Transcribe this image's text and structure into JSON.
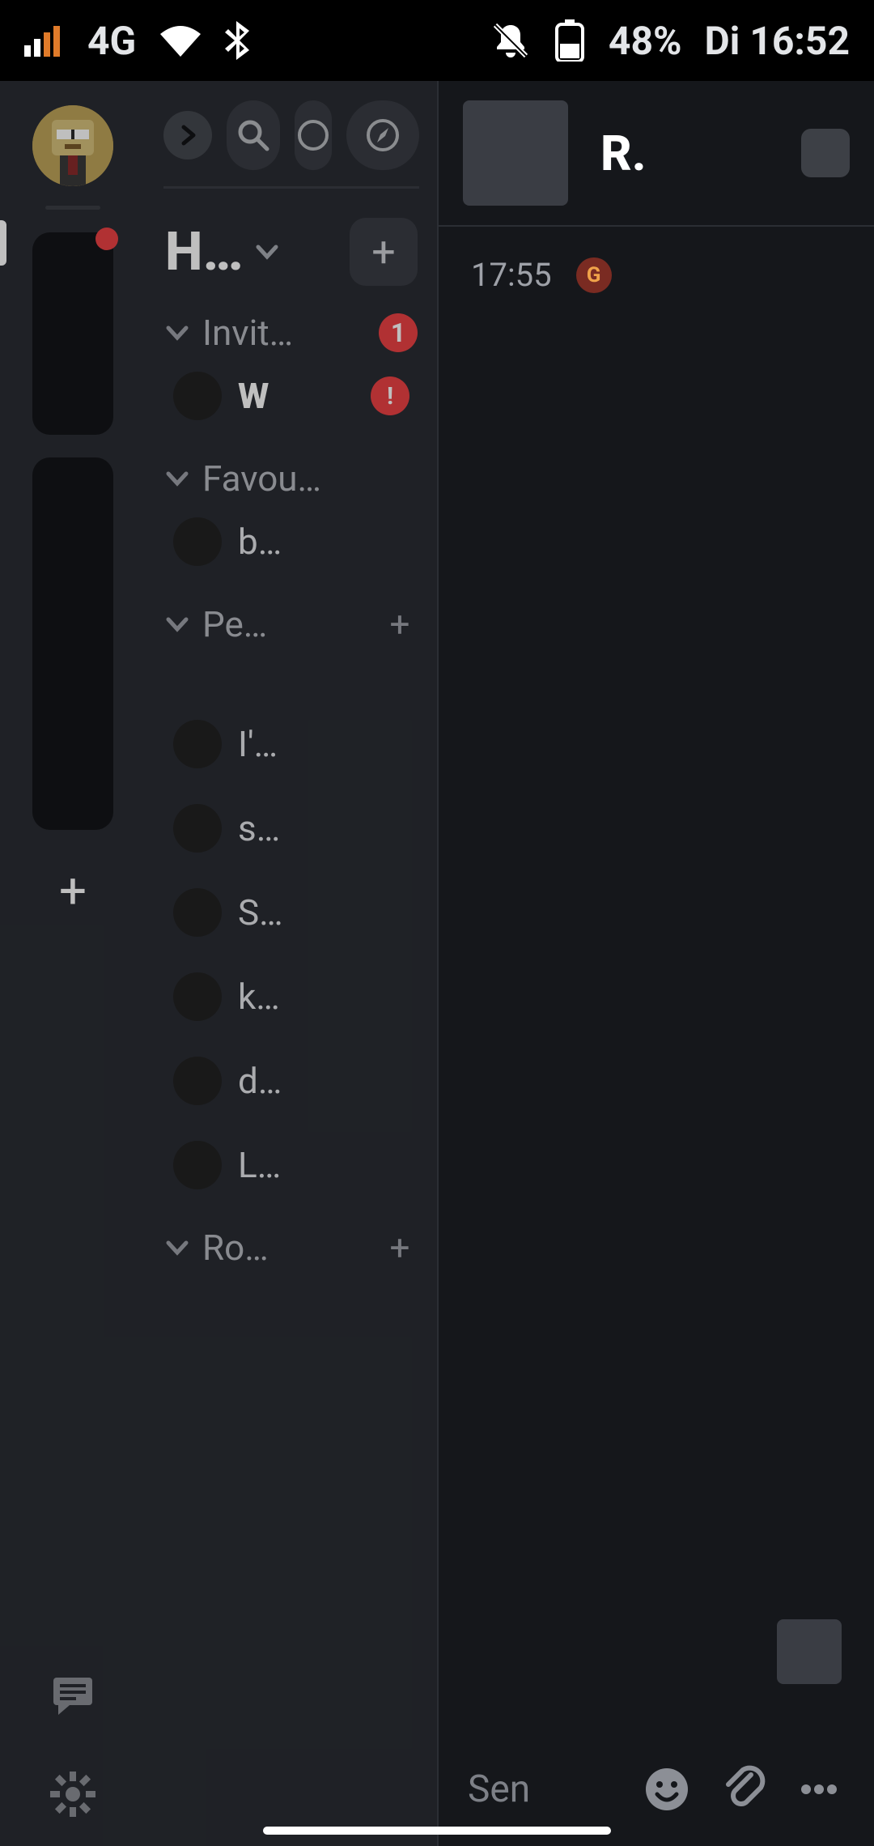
{
  "status": {
    "network": "4G",
    "battery": "48%",
    "time": "Di 16:52"
  },
  "sidebar": {
    "space_name": "H…",
    "sections": {
      "invites": {
        "label": "Invit…",
        "badge": "1",
        "items": [
          {
            "name": "W",
            "alert": "!"
          }
        ]
      },
      "favourites": {
        "label": "Favou…",
        "items": [
          {
            "name": "b…"
          }
        ]
      },
      "people": {
        "label": "Pe…",
        "items": [
          {
            "name": "I'…"
          },
          {
            "name": "s…"
          },
          {
            "name": "S…"
          },
          {
            "name": "k…"
          },
          {
            "name": "d…"
          },
          {
            "name": "L…"
          }
        ]
      },
      "rooms": {
        "label": "Ro…"
      }
    }
  },
  "chat": {
    "title": "R.",
    "message_time": "17:55",
    "message_badge": "G",
    "composer_placeholder": "Sen"
  }
}
